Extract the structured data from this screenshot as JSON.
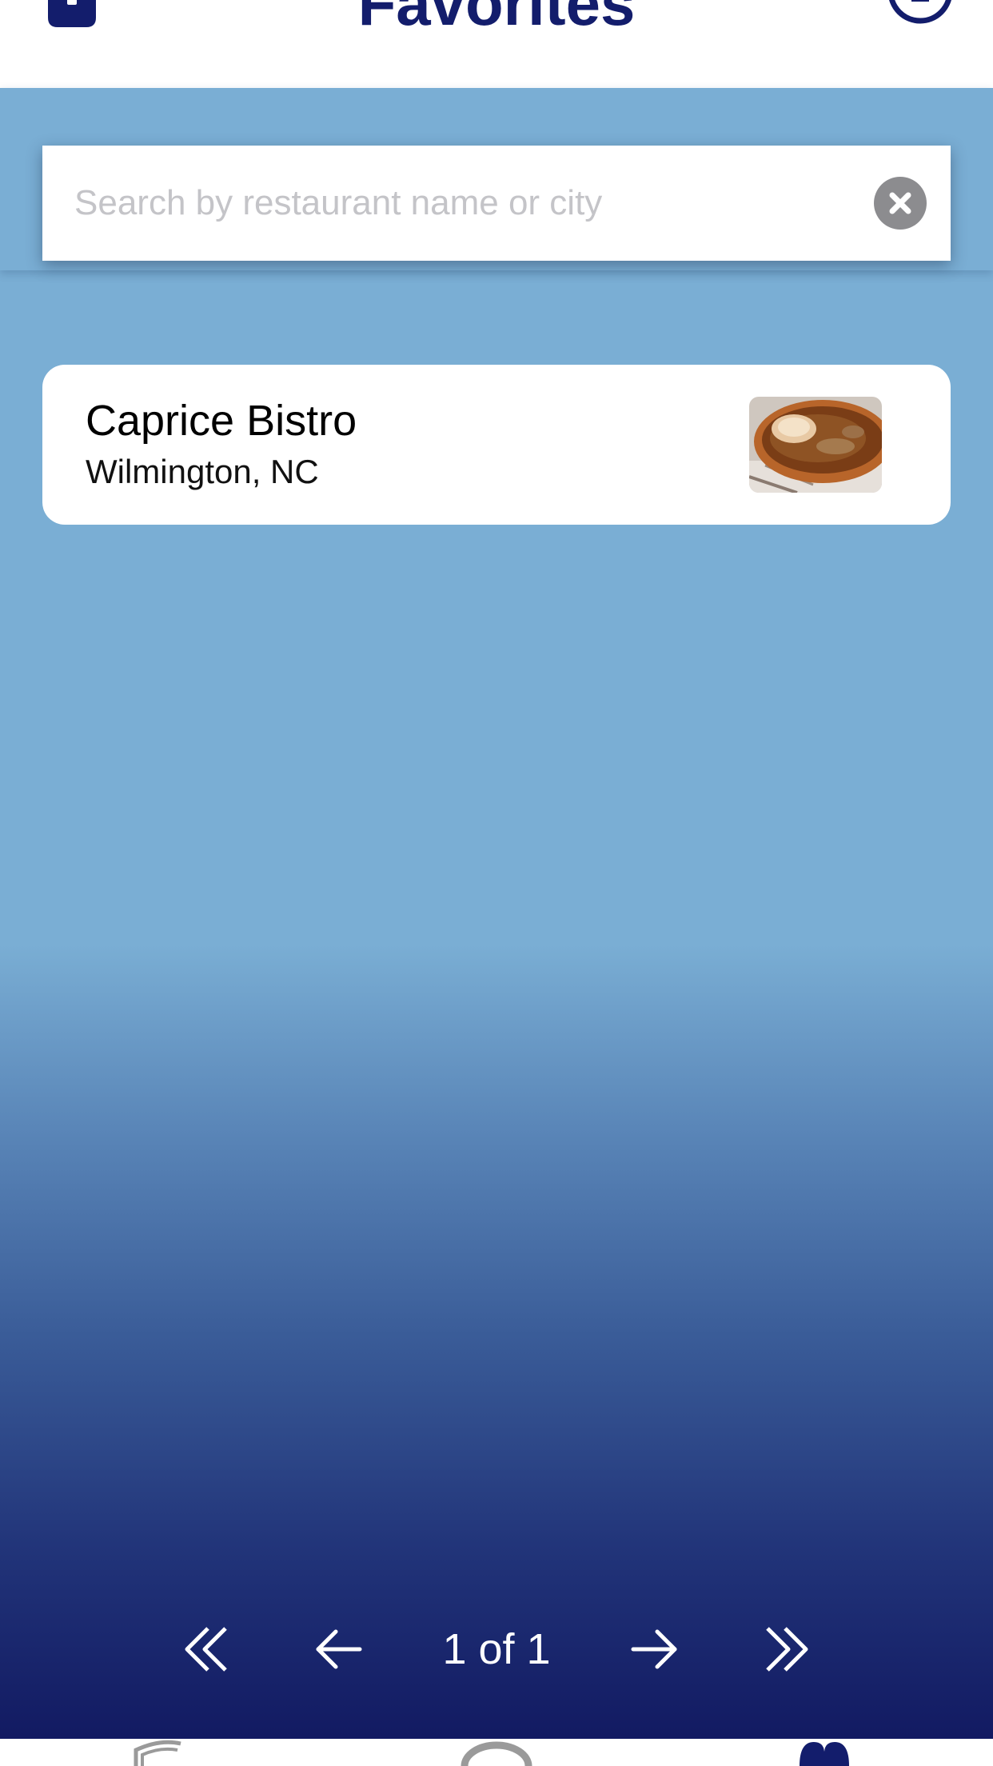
{
  "header": {
    "title": "Favorites",
    "left_icon": "phone-icon",
    "right_icon": "info-icon"
  },
  "search": {
    "placeholder": "Search by restaurant name or city",
    "value": "",
    "clear_icon": "clear-x-icon"
  },
  "results": [
    {
      "name": "Caprice Bistro",
      "city": "Wilmington, NC",
      "thumbnail": "soup-bowl-photo"
    }
  ],
  "pagination": {
    "indicator": "1 of 1",
    "first_icon": "double-chevron-left-icon",
    "prev_icon": "arrow-left-icon",
    "next_icon": "arrow-right-icon",
    "last_icon": "double-chevron-right-icon"
  },
  "tabbar": {
    "tabs": [
      "restaurants-tab-icon",
      "search-tab-icon",
      "favorites-tab-icon"
    ],
    "active_tab": "favorites-tab-icon"
  },
  "colors": {
    "accent": "#131d6c",
    "background_top": "#7aaed4",
    "background_bottom": "#121a62",
    "clear_button": "#8c8c8f",
    "placeholder": "#c4c4c8"
  }
}
